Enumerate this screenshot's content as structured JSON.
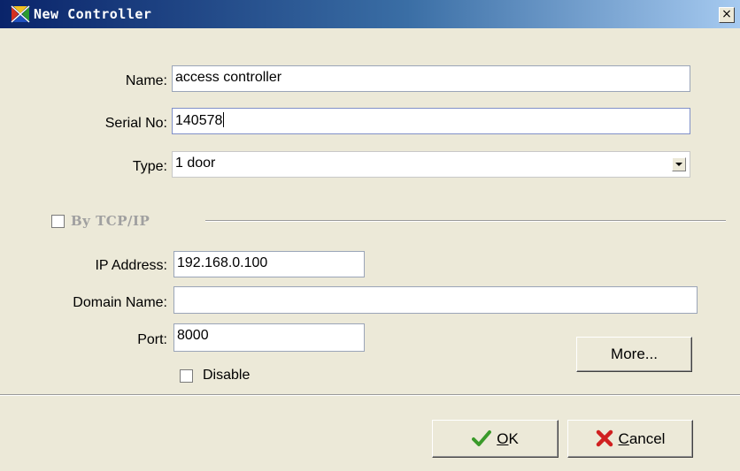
{
  "window": {
    "title": "New Controller",
    "close_glyph": "×",
    "app_icon": "controller-app-icon"
  },
  "form": {
    "name_label": "Name:",
    "name_value": "access controller",
    "serial_label": "Serial No:",
    "serial_value": "140578",
    "type_label": "Type:",
    "type_value": "1 door"
  },
  "tcp": {
    "checkbox_label": "By TCP/IP",
    "checked": false,
    "ip_label": "IP Address:",
    "ip_value": "192.168.0.100",
    "domain_label": "Domain Name:",
    "domain_value": "",
    "port_label": "Port:",
    "port_value": "8000",
    "disable_label": "Disable",
    "disable_checked": false,
    "more_label": "More..."
  },
  "buttons": {
    "ok_mnemonic": "O",
    "ok_rest": "K",
    "ok_icon": "checkmark-icon",
    "cancel_mnemonic": "C",
    "cancel_rest": "ancel",
    "cancel_icon": "x-icon"
  },
  "colors": {
    "titlebar_start": "#0a246a",
    "titlebar_end": "#a6caf0",
    "dialog_bg": "#ece9d8",
    "ok_icon": "#3a9a2a",
    "cancel_icon": "#d02020"
  }
}
